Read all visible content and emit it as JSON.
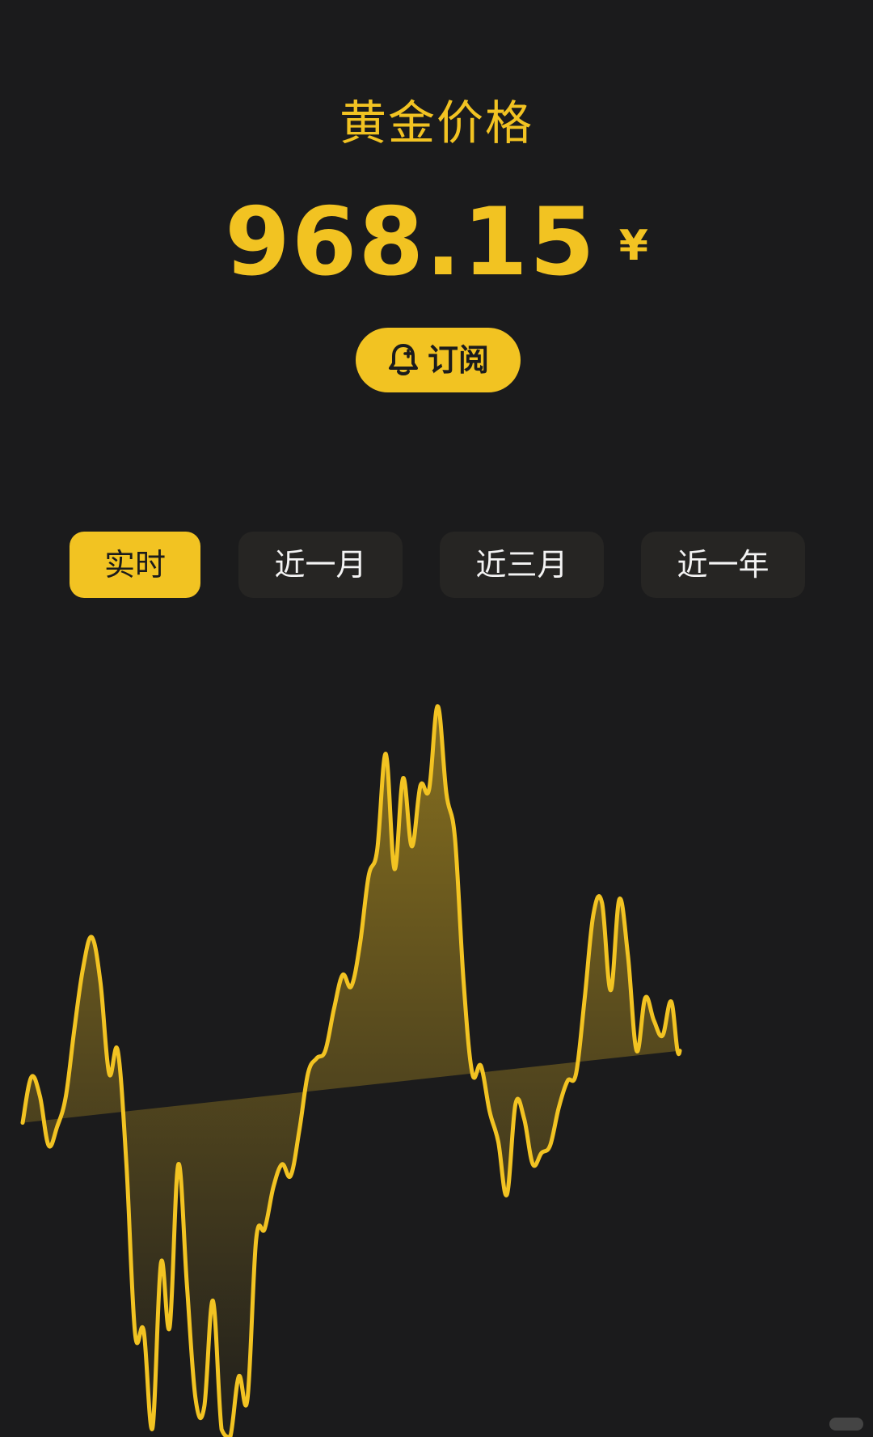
{
  "header": {
    "title": "黄金价格",
    "price": "968.15",
    "currency": "¥"
  },
  "subscribe": {
    "label": "订阅",
    "icon": "bell-icon"
  },
  "tabs": [
    {
      "label": "实时",
      "active": true
    },
    {
      "label": "近一月",
      "active": false
    },
    {
      "label": "近三月",
      "active": false
    },
    {
      "label": "近一年",
      "active": false
    }
  ],
  "colors": {
    "background": "#1b1b1c",
    "accent": "#f2c322",
    "tab_inactive": "#262523",
    "tab_inactive_text": "#f4f4f4"
  },
  "chart_data": {
    "type": "area",
    "title": "",
    "xlabel": "",
    "ylabel": "",
    "ylim": [
      0,
      100
    ],
    "grid": false,
    "x": [
      0,
      1,
      2,
      3,
      4,
      5,
      6,
      7,
      8,
      9,
      10,
      11,
      12,
      13,
      14,
      15,
      16,
      17,
      18,
      19,
      20,
      21,
      22,
      23,
      24,
      25,
      26,
      27,
      28,
      29,
      30,
      31,
      32,
      33,
      34,
      35,
      36,
      37,
      38,
      39,
      40,
      41,
      42,
      43,
      44,
      45,
      46,
      47,
      48,
      49,
      50,
      51,
      52,
      53,
      54,
      55,
      56,
      57,
      58,
      59,
      60,
      61,
      62,
      63,
      64,
      65,
      66,
      67,
      68,
      69,
      70,
      71,
      72,
      73,
      74,
      75,
      76,
      77,
      78,
      79,
      80,
      81,
      82,
      83,
      84,
      85,
      86,
      87,
      88,
      89,
      90,
      91,
      92,
      93,
      94,
      95,
      96
    ],
    "values": [
      41.5,
      47.5,
      45,
      38.5,
      41,
      45,
      54,
      62,
      66,
      60,
      48,
      51,
      36,
      13.7,
      14,
      1.1,
      23,
      14.5,
      36,
      20,
      5,
      4,
      18,
      1,
      0,
      8,
      5,
      26,
      27.5,
      33,
      36,
      34.5,
      40.5,
      48,
      50,
      51,
      56.5,
      61,
      59.5,
      65,
      74,
      77.5,
      90.2,
      75,
      87,
      78,
      86,
      85.5,
      96.5,
      85,
      79,
      60,
      48,
      49,
      43,
      39,
      32,
      44,
      42,
      36,
      37.5,
      38.5,
      43.5,
      47,
      48,
      58,
      69,
      70.5,
      59,
      71,
      63.5,
      51,
      58,
      55,
      53,
      57.5,
      51,
      71
    ]
  }
}
